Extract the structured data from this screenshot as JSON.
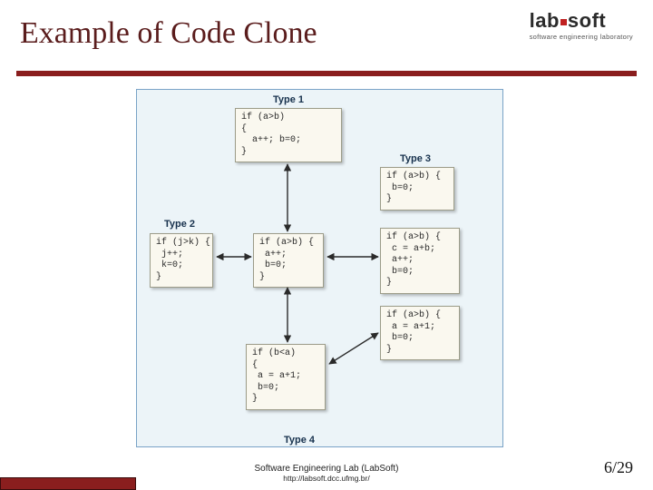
{
  "domain": "Diagram",
  "title": "Example of Code Clone",
  "logo": {
    "text": "lab soft",
    "sub": "software engineering laboratory"
  },
  "groups": {
    "t1": "Type 1",
    "t2": "Type 2",
    "t3": "Type 3",
    "t4": "Type 4"
  },
  "boxes": {
    "type1": "if (a>b)\n{\n  a++; b=0;\n}",
    "type2a": "if (j>k) {\n j++;\n k=0;\n}",
    "type2b": "if (a>b) {\n a++;\n b=0;\n}",
    "type3a": "if (a>b) {\n b=0;\n}",
    "type3b": "if (a>b) {\n c = a+b;\n a++;\n b=0;\n}",
    "type3c": "if (a>b) {\n a = a+1;\n b=0;\n}",
    "type4a": "if (b<a)\n{\n a = a+1;\n b=0;\n}"
  },
  "footer": {
    "line1": "Software Engineering Lab (LabSoft)",
    "line2": "http://labsoft.dcc.ufmg.br/"
  },
  "page": "6/29"
}
